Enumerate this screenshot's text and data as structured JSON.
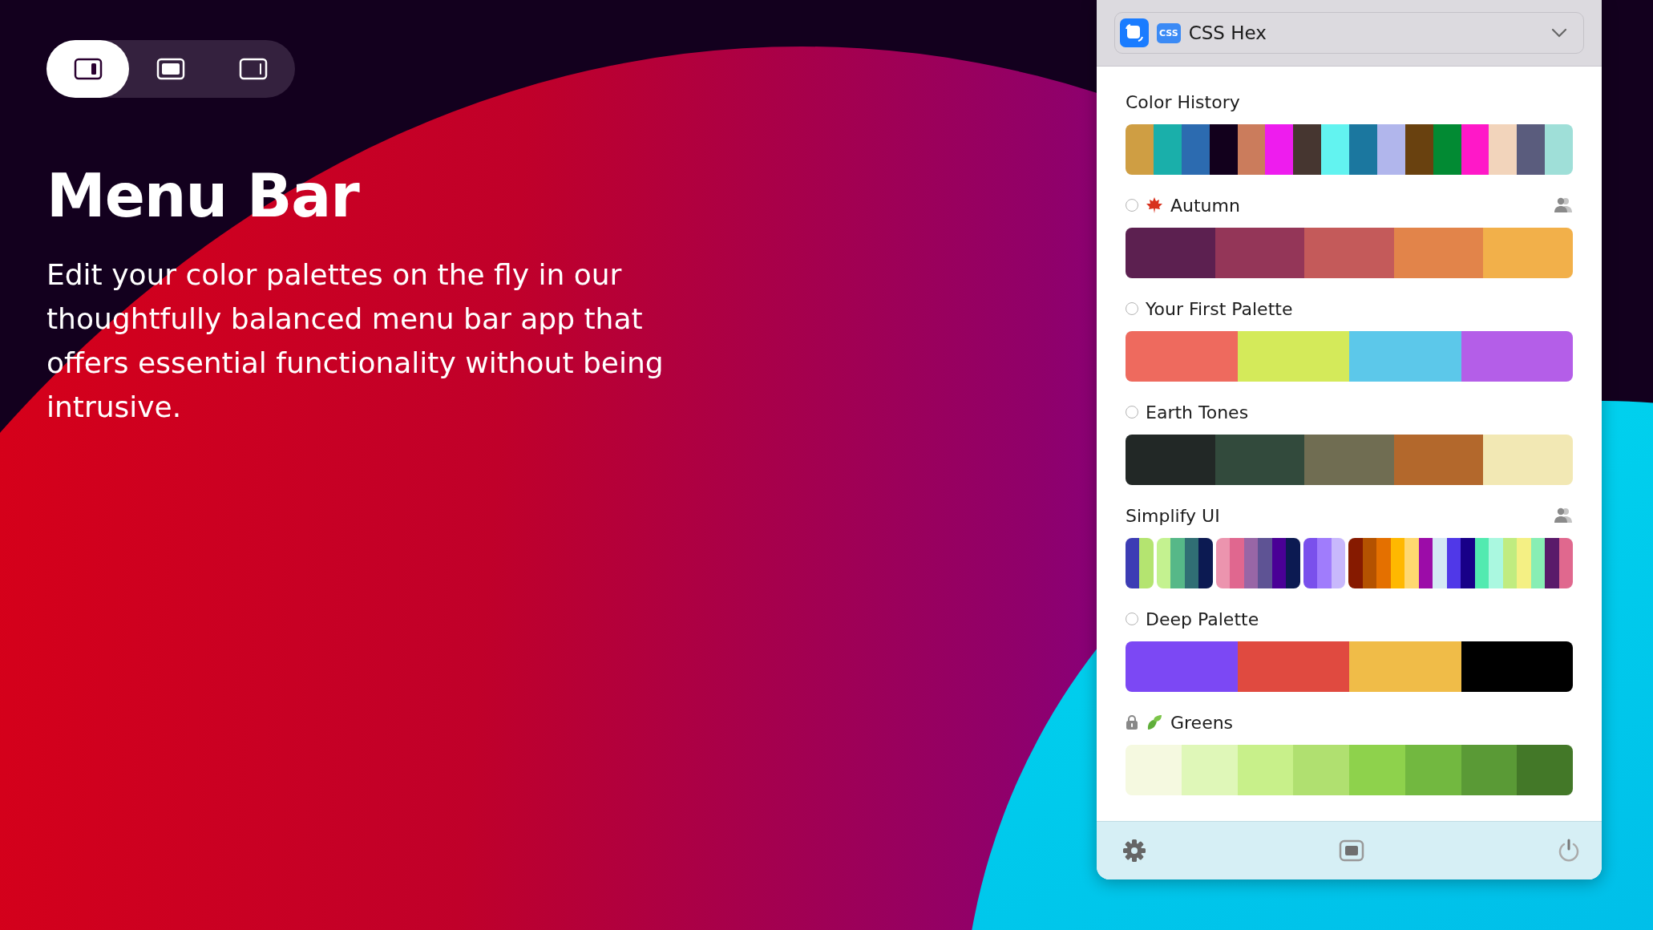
{
  "layout_toggle": [
    {
      "kind": "left",
      "selected": true
    },
    {
      "kind": "full",
      "selected": false
    },
    {
      "kind": "right",
      "selected": false
    }
  ],
  "hero": {
    "title": "Menu Bar",
    "text": "Edit your color palettes on the fly in our thoughtfully balanced menu bar app that offers essential functionality without being intrusive."
  },
  "panel": {
    "format": "CSS Hex",
    "format_badge": "CSS",
    "history": {
      "title": "Color History",
      "swatches": [
        {
          "color": "#cf9e43"
        },
        {
          "color": "#1aafaa"
        },
        {
          "color": "#2c6bb0"
        },
        {
          "color": "#12001c"
        },
        {
          "color": "#cb7c5c"
        },
        {
          "color": "#ee1cee"
        },
        {
          "color": "#463630"
        },
        {
          "color": "#62f3f0"
        },
        {
          "color": "#1b779f"
        },
        {
          "color": "#b1b6ec"
        },
        {
          "color": "#69410f"
        },
        {
          "color": "#028a33"
        },
        {
          "color": "#ff18c8"
        },
        {
          "color": "#f2d4bb"
        },
        {
          "color": "#5a5c7d"
        },
        {
          "color": "#9fdfd8"
        }
      ]
    },
    "palettes": [
      {
        "name": "Autumn",
        "kind": "mapleradio",
        "selected": false,
        "shared": true,
        "groups": [
          {
            "swatches": [
              {
                "color": "#5c2050"
              },
              {
                "color": "#943658"
              },
              {
                "color": "#c45a5a"
              },
              {
                "color": "#e2844a"
              },
              {
                "color": "#f2b04a"
              }
            ]
          }
        ]
      },
      {
        "name": "Your First Palette",
        "kind": "radio",
        "selected": false,
        "shared": false,
        "groups": [
          {
            "swatches": [
              {
                "color": "#ee6a5e"
              },
              {
                "color": "#d4ea5a"
              },
              {
                "color": "#5cc8ea"
              },
              {
                "color": "#b45ee8"
              }
            ]
          }
        ]
      },
      {
        "name": "Earth Tones",
        "kind": "radio",
        "selected": false,
        "shared": false,
        "groups": [
          {
            "swatches": [
              {
                "color": "#222826"
              },
              {
                "color": "#324a3c"
              },
              {
                "color": "#706d52"
              },
              {
                "color": "#b3682c"
              },
              {
                "color": "#f2e8b4"
              }
            ]
          }
        ]
      },
      {
        "name": "Simplify UI",
        "kind": "plain",
        "shared": true,
        "groups": [
          {
            "swatches": [
              {
                "color": "#3c3cb4"
              },
              {
                "color": "#b4e470"
              }
            ]
          },
          {
            "swatches": [
              {
                "color": "#c4f290"
              },
              {
                "color": "#56b888"
              },
              {
                "color": "#306e74"
              },
              {
                "color": "#0c1a52"
              }
            ]
          },
          {
            "swatches": [
              {
                "color": "#ec94ae"
              },
              {
                "color": "#e0678f"
              },
              {
                "color": "#9866a6"
              },
              {
                "color": "#5e5394"
              },
              {
                "color": "#4a0096"
              },
              {
                "color": "#0c1a52"
              }
            ]
          },
          {
            "swatches": [
              {
                "color": "#7a50ec"
              },
              {
                "color": "#a07cfc"
              },
              {
                "color": "#c8b8fc"
              }
            ]
          },
          {
            "swatches": [
              {
                "color": "#861a00"
              },
              {
                "color": "#b45200"
              },
              {
                "color": "#e47000"
              },
              {
                "color": "#ffb800"
              },
              {
                "color": "#ffd870"
              },
              {
                "color": "#9c0ca8"
              },
              {
                "color": "#d4e8f4"
              },
              {
                "color": "#5038e8"
              },
              {
                "color": "#180088"
              },
              {
                "color": "#52eab0"
              },
              {
                "color": "#aaf8e0"
              },
              {
                "color": "#c0ec80"
              },
              {
                "color": "#f4f084"
              },
              {
                "color": "#88eeb4"
              },
              {
                "color": "#5a1a6a"
              },
              {
                "color": "#e0688e"
              }
            ]
          }
        ]
      },
      {
        "name": "Deep Palette",
        "kind": "radio",
        "selected": false,
        "shared": false,
        "groups": [
          {
            "swatches": [
              {
                "color": "#7c48f4"
              },
              {
                "color": "#e04a40"
              },
              {
                "color": "#f0bc48"
              },
              {
                "color": "#000000"
              }
            ]
          }
        ]
      },
      {
        "name": "Greens",
        "kind": "leaflocked",
        "shared": false,
        "groups": [
          {
            "swatches": [
              {
                "color": "#f5f9e0"
              },
              {
                "color": "#dff7b8"
              },
              {
                "color": "#c8f08a"
              },
              {
                "color": "#b0e070"
              },
              {
                "color": "#8ed24c"
              },
              {
                "color": "#72b840"
              },
              {
                "color": "#5a9a36"
              },
              {
                "color": "#437828"
              }
            ]
          }
        ]
      }
    ]
  }
}
